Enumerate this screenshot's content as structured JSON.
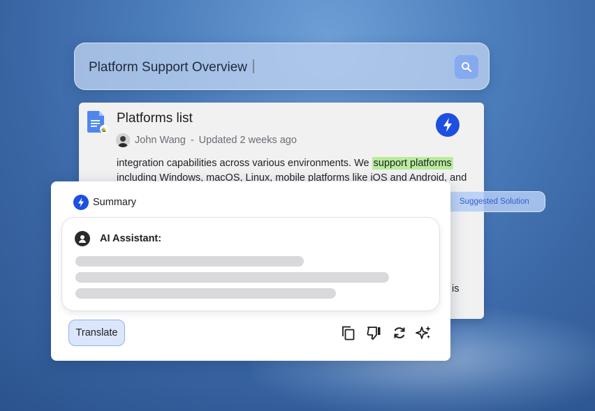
{
  "search": {
    "query": "Platform Support Overview",
    "button_icon": "search-icon"
  },
  "document": {
    "title": "Platforms list",
    "author": "John Wang",
    "separator": "-",
    "updated": "Updated 2 weeks ago",
    "body_before": "integration capabilities across various environments. We ",
    "highlight": "support platforms",
    "body_line2": "including Windows, macOS, Linux, mobile platforms like iOS and Android, and",
    "tail": "is",
    "icons": [
      "google-doc-icon",
      "bolt-icon"
    ],
    "highlight_color": "#b8ec9c"
  },
  "suggestion": {
    "label": "Suggested Solution",
    "icon": "sparkle-icon"
  },
  "summary": {
    "heading": "Summary",
    "assistant_label": "AI Assistant:",
    "translate_label": "Translate",
    "actions": [
      "copy-icon",
      "dislike-icon",
      "regenerate-icon",
      "sparkle-icon"
    ],
    "accent": "#1d4fe0"
  }
}
